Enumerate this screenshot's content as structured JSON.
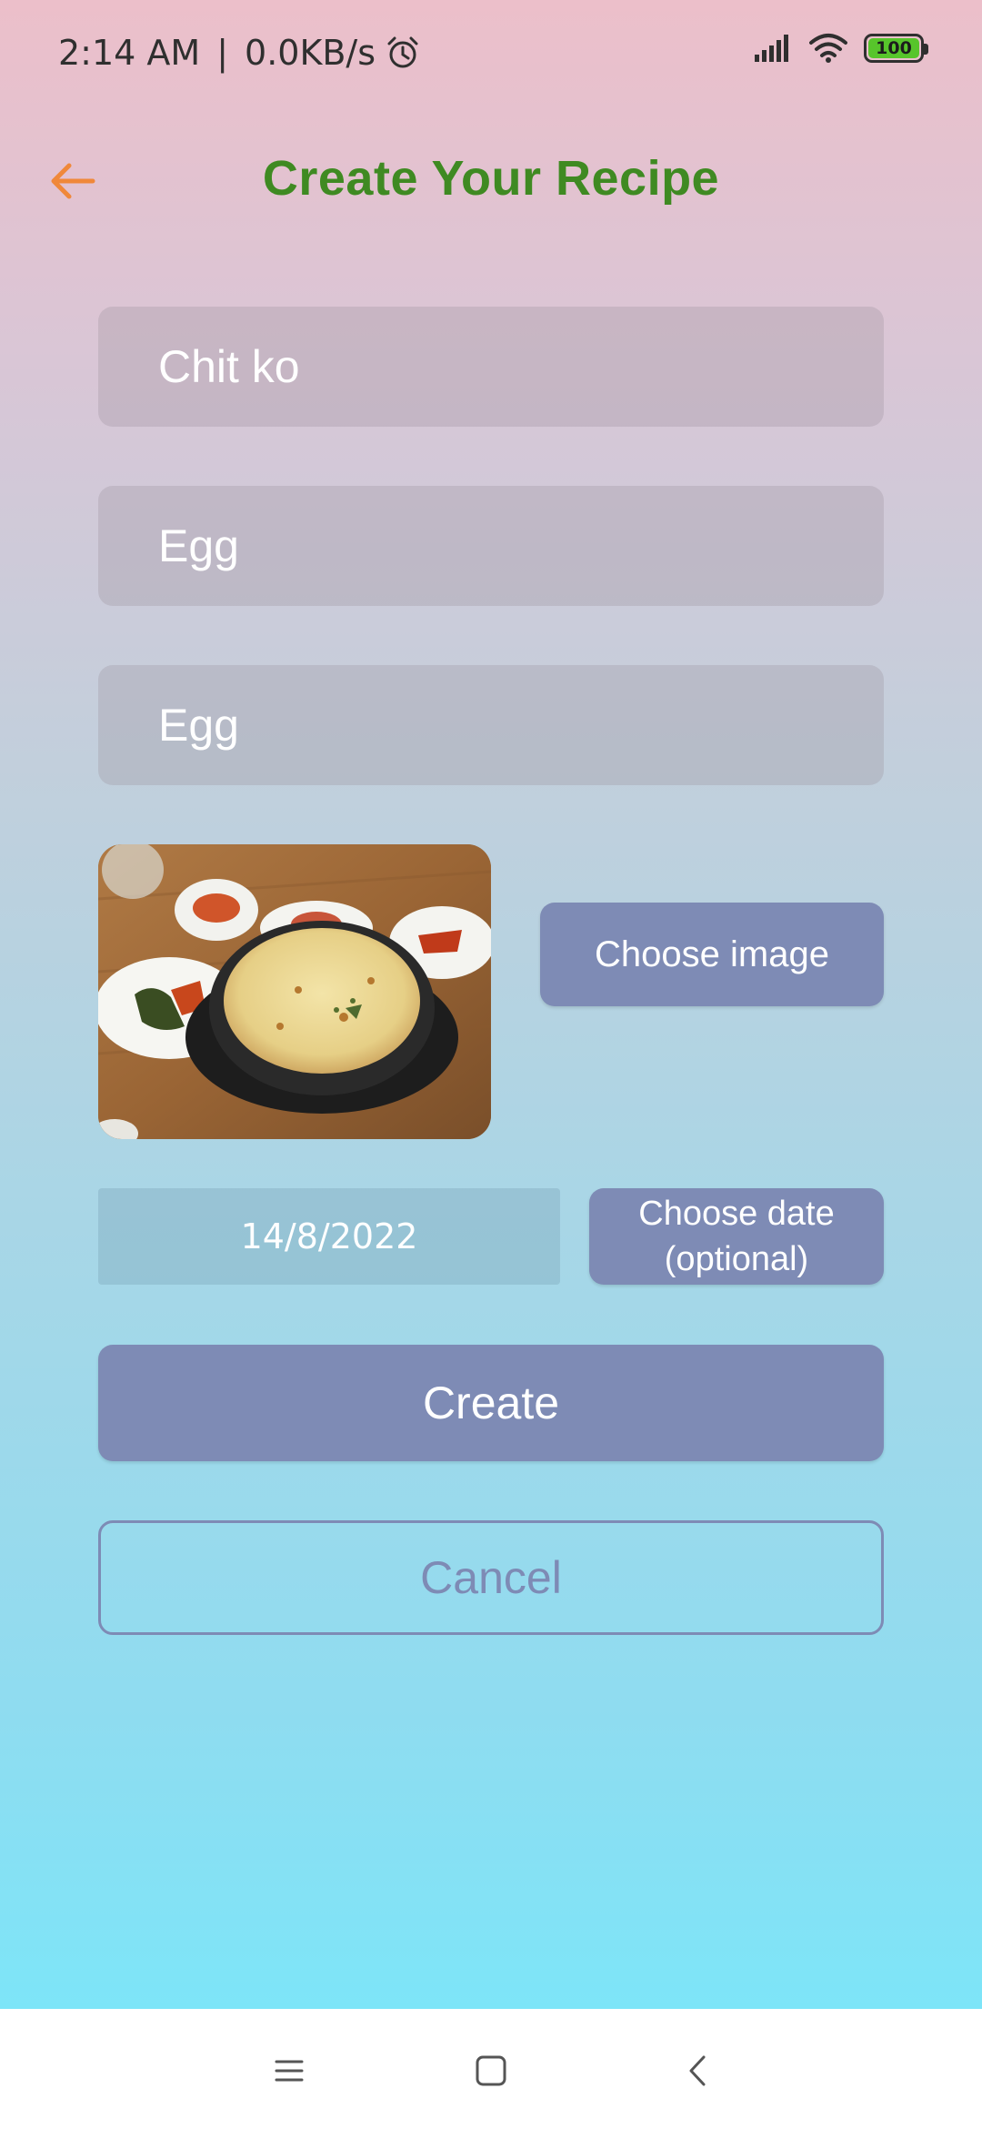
{
  "status_bar": {
    "time": "2:14  AM",
    "separator": "|",
    "network_speed": "0.0KB/s",
    "battery_level": "100",
    "icons": [
      "alarm-icon",
      "signal-icon",
      "wifi-icon",
      "battery-icon"
    ]
  },
  "header": {
    "title": "Create Your Recipe",
    "back_icon": "arrow-left-icon"
  },
  "form": {
    "name_value": "Chit ko",
    "ingredient_1_value": "Egg",
    "ingredient_2_value": "Egg",
    "choose_image_label": "Choose image",
    "date_value": "14/8/2022",
    "choose_date_label_line1": "Choose date",
    "choose_date_label_line2": "(optional)",
    "create_label": "Create",
    "cancel_label": "Cancel"
  },
  "nav_bar": {
    "icons": [
      "menu-icon",
      "home-icon",
      "back-icon"
    ]
  },
  "colors": {
    "title": "#3f8a22",
    "back_arrow": "#f0883a",
    "button": "#7e8bb5"
  }
}
